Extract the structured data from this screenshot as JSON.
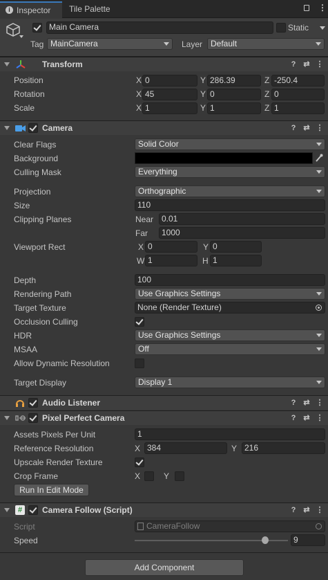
{
  "tabs": {
    "inspector": "Inspector",
    "tile_palette": "Tile Palette"
  },
  "object": {
    "name": "Main Camera",
    "active": true,
    "static_label": "Static",
    "tag_label": "Tag",
    "tag_value": "MainCamera",
    "layer_label": "Layer",
    "layer_value": "Default"
  },
  "transform": {
    "title": "Transform",
    "position_label": "Position",
    "rotation_label": "Rotation",
    "scale_label": "Scale",
    "x": "X",
    "y": "Y",
    "z": "Z",
    "position": [
      "0",
      "286.39",
      "-250.4"
    ],
    "rotation": [
      "45",
      "0",
      "0"
    ],
    "scale": [
      "1",
      "1",
      "1"
    ]
  },
  "camera": {
    "title": "Camera",
    "enabled": true,
    "clear_flags_label": "Clear Flags",
    "clear_flags": "Solid Color",
    "background_label": "Background",
    "background_color": "#000000",
    "culling_mask_label": "Culling Mask",
    "culling_mask": "Everything",
    "projection_label": "Projection",
    "projection": "Orthographic",
    "size_label": "Size",
    "size": "110",
    "clipping_label": "Clipping Planes",
    "near_label": "Near",
    "near": "0.01",
    "far_label": "Far",
    "far": "1000",
    "viewport_label": "Viewport Rect",
    "vx_label": "X",
    "vx": "0",
    "vy_label": "Y",
    "vy": "0",
    "vw_label": "W",
    "vw": "1",
    "vh_label": "H",
    "vh": "1",
    "depth_label": "Depth",
    "depth": "100",
    "rendering_path_label": "Rendering Path",
    "rendering_path": "Use Graphics Settings",
    "target_texture_label": "Target Texture",
    "target_texture": "None (Render Texture)",
    "occlusion_label": "Occlusion Culling",
    "occlusion": true,
    "hdr_label": "HDR",
    "hdr": "Use Graphics Settings",
    "msaa_label": "MSAA",
    "msaa": "Off",
    "dynamic_res_label": "Allow Dynamic Resolution",
    "dynamic_res": false,
    "target_display_label": "Target Display",
    "target_display": "Display 1"
  },
  "audio_listener": {
    "title": "Audio Listener",
    "enabled": true
  },
  "pixel_perfect": {
    "title": "Pixel Perfect Camera",
    "enabled": true,
    "ppu_label": "Assets Pixels Per Unit",
    "ppu": "1",
    "ref_res_label": "Reference Resolution",
    "ref_x_label": "X",
    "ref_x": "384",
    "ref_y_label": "Y",
    "ref_y": "216",
    "upscale_label": "Upscale Render Texture",
    "upscale": true,
    "crop_label": "Crop Frame",
    "crop_x_label": "X",
    "crop_y_label": "Y",
    "run_button": "Run In Edit Mode"
  },
  "camera_follow": {
    "title": "Camera Follow (Script)",
    "enabled": true,
    "script_label": "Script",
    "script_value": "CameraFollow",
    "speed_label": "Speed",
    "speed": "9",
    "speed_slider_fraction": 0.85
  },
  "add_component": "Add Component",
  "colors": {
    "accent": "#3a79bb",
    "background": "#383838",
    "field": "#2a2a2a"
  }
}
